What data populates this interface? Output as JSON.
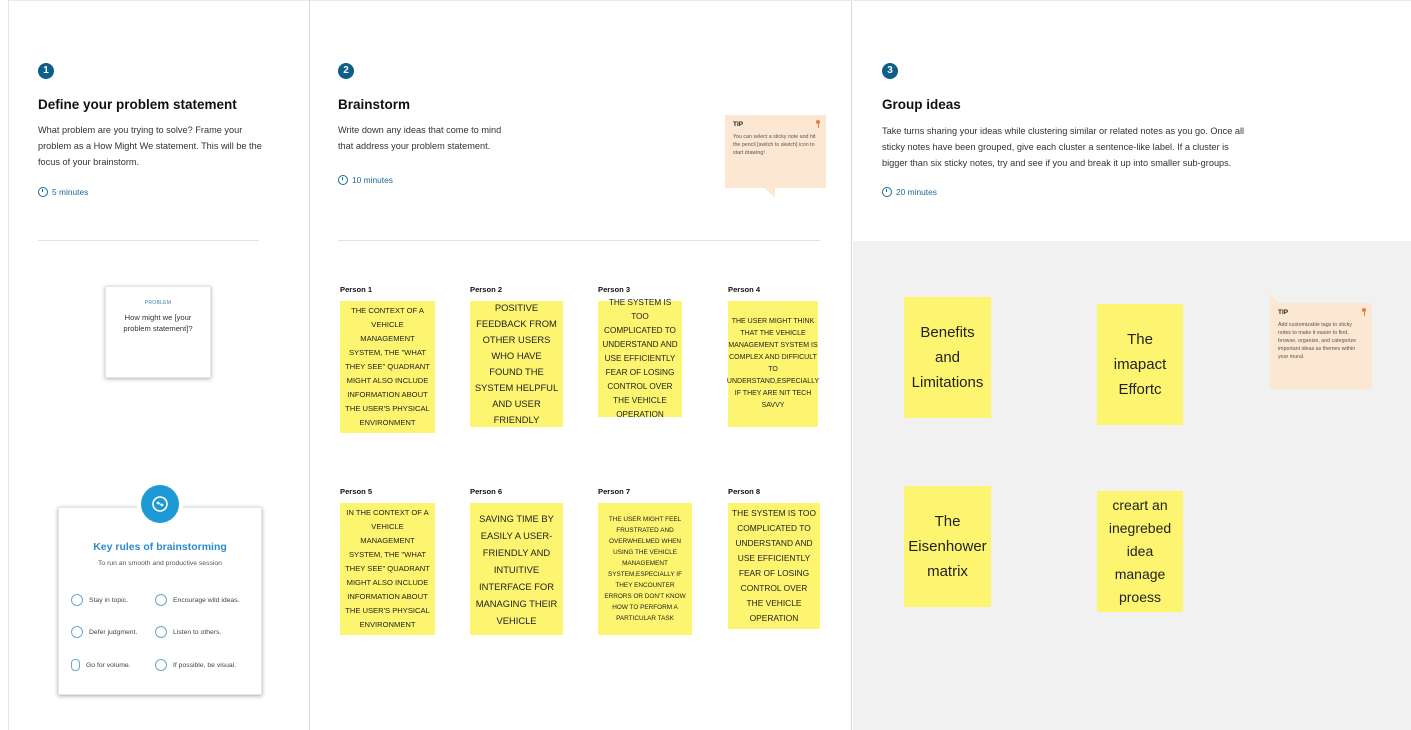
{
  "step1": {
    "number": "1",
    "title": "Define your problem statement",
    "description": "What problem are you trying to solve? Frame your problem as a How Might We statement. This will be the focus of your brainstorm.",
    "timer": "5 minutes",
    "problem_card": {
      "label": "PROBLEM",
      "text": "How might we [your problem statement]?"
    },
    "rules": {
      "title": "Key rules of brainstorming",
      "subtitle": "To run an smooth and productive session",
      "items": [
        {
          "label": "Stay in topic.",
          "icon": "target-icon"
        },
        {
          "label": "Encourage wild ideas.",
          "icon": "lightbulb-icon"
        },
        {
          "label": "Defer judgment.",
          "icon": "chat-icon"
        },
        {
          "label": "Listen to others.",
          "icon": "ear-icon"
        },
        {
          "label": "Go for volume.",
          "icon": "stack-icon"
        },
        {
          "label": "If possible, be visual.",
          "icon": "eye-icon"
        }
      ]
    }
  },
  "step2": {
    "number": "2",
    "title": "Brainstorm",
    "description": "Write down any ideas that come to mind that address your problem statement.",
    "timer": "10 minutes",
    "tip": {
      "label": "TIP",
      "text": "You can select a sticky note and hit the pencil [switch to sketch] icon to start drawing!"
    },
    "persons": [
      {
        "label": "Person 1",
        "note": "THE CONTEXT OF A VEHICLE MANAGEMENT SYSTEM, THE \"WHAT THEY SEE\" QUADRANT MIGHT ALSO INCLUDE INFORMATION ABOUT THE USER'S PHYSICAL ENVIRONMENT"
      },
      {
        "label": "Person 2",
        "note": "POSITIVE FEEDBACK FROM OTHER USERS WHO HAVE FOUND THE SYSTEM HELPFUL AND USER FRIENDLY"
      },
      {
        "label": "Person 3",
        "note": "THE SYSTEM IS TOO COMPLICATED TO UNDERSTAND AND USE EFFICIENTLY FEAR OF LOSING CONTROL OVER THE VEHICLE OPERATION"
      },
      {
        "label": "Person 4",
        "note": "THE USER MIGHT THINK THAT THE VEHICLE MANAGEMENT SYSTEM IS COMPLEX AND DIFFICULT TO UNDERSTAND,ESPECIALLY IF THEY ARE NIT TECH SAVVY"
      },
      {
        "label": "Person 5",
        "note": "IN THE CONTEXT OF A VEHICLE MANAGEMENT SYSTEM, THE \"WHAT THEY SEE\" QUADRANT MIGHT ALSO INCLUDE INFORMATION ABOUT THE USER'S PHYSICAL ENVIRONMENT"
      },
      {
        "label": "Person 6",
        "note": "SAVING TIME BY EASILY A USER-FRIENDLY AND INTUITIVE INTERFACE FOR MANAGING THEIR VEHICLE"
      },
      {
        "label": "Person 7",
        "note": "THE USER MIGHT FEEL FRUSTRATED AND OVERWHELMED WHEN USING THE VEHICLE MANAGEMENT SYSTEM,ESPECIALLY IF THEY ENCOUNTER ERRORS OR DON'T KNOW HOW TO PERFORM A PARTICULAR TASK"
      },
      {
        "label": "Person 8",
        "note": "THE SYSTEM IS TOO COMPLICATED TO UNDERSTAND AND USE EFFICIENTLY FEAR OF LOSING CONTROL OVER THE VEHICLE OPERATION"
      }
    ]
  },
  "step3": {
    "number": "3",
    "title": "Group ideas",
    "description": "Take turns sharing your ideas while clustering similar or related notes as you go. Once all sticky notes have been grouped, give each cluster a sentence-like label. If a cluster is bigger than six sticky notes, try and see if you and break it up into smaller sub-groups.",
    "timer": "20 minutes",
    "tip": {
      "label": "TIP",
      "text": "Add customizable tags to sticky notes to make it easier to find, browse, organize, and categorize important ideas as themes within your mural."
    },
    "groups": [
      "Benefits and Limitations",
      "The imapact Effortc",
      "The Eisenhower matrix",
      "creart an inegrebed idea manage proess"
    ]
  },
  "colors": {
    "sticky": "#fdf570",
    "accent": "#0b5f88",
    "rules_title": "#2c8ccf",
    "tip": "#fce8d2"
  }
}
